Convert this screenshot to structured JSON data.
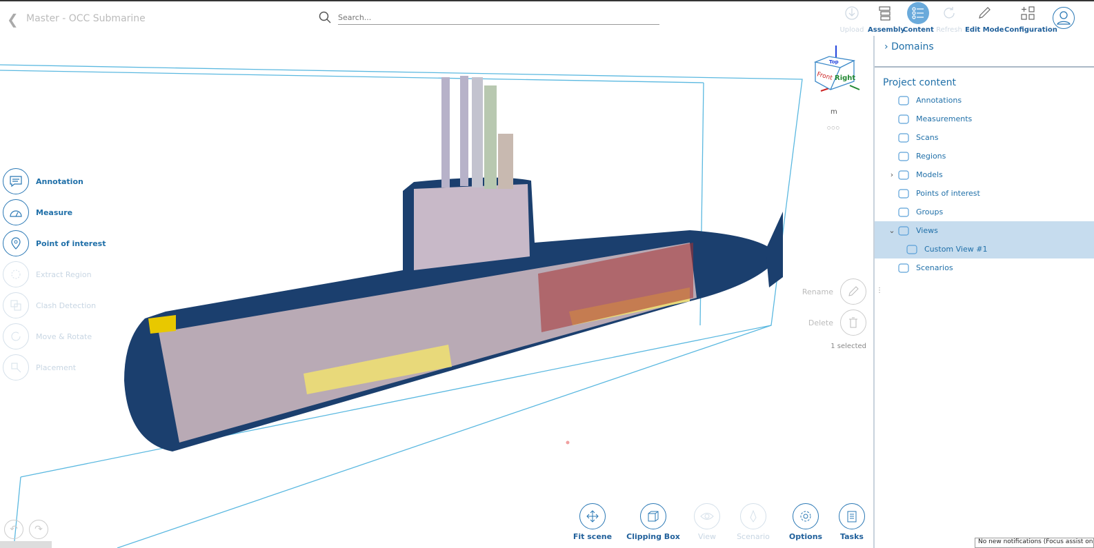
{
  "header": {
    "title": "Master - OCC Submarine",
    "search_placeholder": "Search...",
    "toolbar": [
      {
        "label": "Upload",
        "icon": "download-icon",
        "enabled": false
      },
      {
        "label": "Assembly",
        "icon": "assembly-icon",
        "enabled": true
      },
      {
        "label": "Content",
        "icon": "list-icon",
        "enabled": true,
        "active": true
      },
      {
        "label": "Refresh",
        "icon": "refresh-icon",
        "enabled": false
      },
      {
        "label": "Edit Mode",
        "icon": "pencil-icon",
        "enabled": true
      },
      {
        "label": "Configuration",
        "icon": "configuration-icon",
        "enabled": true
      }
    ]
  },
  "viewcube": {
    "top": "Top",
    "front": "Front",
    "right": "Right",
    "unit": "m",
    "more": "○○○"
  },
  "left_tools": [
    {
      "label": "Annotation",
      "enabled": true
    },
    {
      "label": "Measure",
      "enabled": true
    },
    {
      "label": "Point of interest",
      "enabled": true
    },
    {
      "label": "Extract Region",
      "enabled": false
    },
    {
      "label": "Clash Detection",
      "enabled": false
    },
    {
      "label": "Move & Rotate",
      "enabled": false
    },
    {
      "label": "Placement",
      "enabled": false
    }
  ],
  "bottom_tools": [
    {
      "label": "Fit scene",
      "enabled": true
    },
    {
      "label": "Clipping Box",
      "enabled": true
    },
    {
      "label": "View",
      "enabled": false
    },
    {
      "label": "Scenario",
      "enabled": false
    },
    {
      "label": "Options",
      "enabled": true
    },
    {
      "label": "Tasks",
      "enabled": true
    }
  ],
  "view_actions": {
    "rename": "Rename",
    "delete": "Delete",
    "selected": "1 selected"
  },
  "panel": {
    "domains": "Domains",
    "project_content": "Project content",
    "items": [
      {
        "label": "Annotations"
      },
      {
        "label": "Measurements"
      },
      {
        "label": "Scans"
      },
      {
        "label": "Regions"
      },
      {
        "label": "Models",
        "expandable": true
      },
      {
        "label": "Points of interest"
      },
      {
        "label": "Groups"
      },
      {
        "label": "Views",
        "expanded": true,
        "selected": true
      },
      {
        "label": "Custom View #1",
        "child": true,
        "selected": true
      },
      {
        "label": "Scenarios"
      }
    ]
  },
  "notification": "No new notifications (Focus assist on)",
  "colors": {
    "accent": "#2a78b5",
    "selection": "#c6dcee",
    "hull": "#1b3f6e",
    "bbox": "#5ab8e0"
  }
}
